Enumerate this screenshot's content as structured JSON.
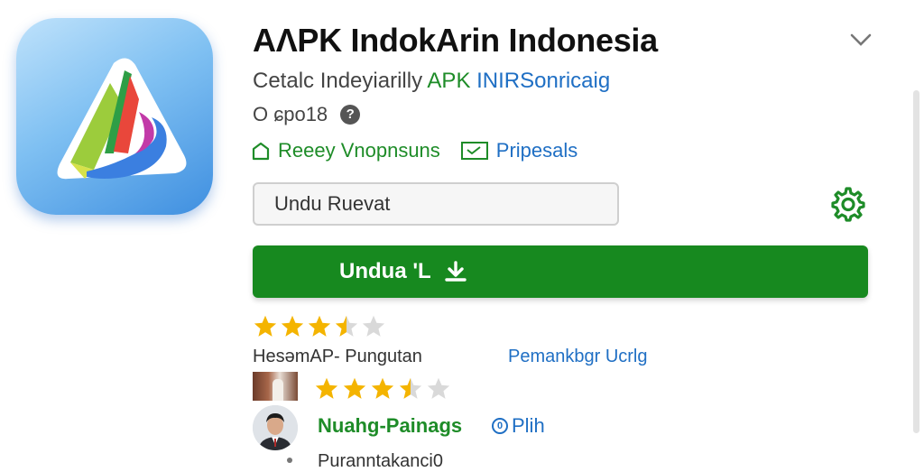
{
  "app": {
    "title": "AɅPK IndokArin Indonesia",
    "icon": "triangle-logo-icon",
    "developer_text": "Cetalc Indeyiarilly",
    "apk_text": "APK",
    "publisher_link": "INIRSonricaig",
    "meta_value": "O ɕpo18",
    "info_icon": "info-icon"
  },
  "tags": [
    {
      "label": "Reeey Vnopnsuns",
      "icon": "home-icon"
    },
    {
      "label": "Pripesals",
      "icon": "mail-icon"
    }
  ],
  "search": {
    "value": "Undu Ruevat"
  },
  "settings": {
    "icon": "gear-icon"
  },
  "download": {
    "label": "Undua 'L",
    "icon": "download-icon"
  },
  "rating": {
    "stars": 3.5,
    "label": "HesəmAP- Pungutan",
    "link": "Pemankbgr Ucrlg"
  },
  "review": {
    "stars": 3.5,
    "reviewer": "Nuahg-Painags",
    "pilih": "Plih",
    "text": "Puranntakanci0"
  },
  "colors": {
    "primary_green": "#17891f",
    "link_blue": "#1f6fc4",
    "star": "#f4b400",
    "star_empty": "#d9d9d9"
  }
}
